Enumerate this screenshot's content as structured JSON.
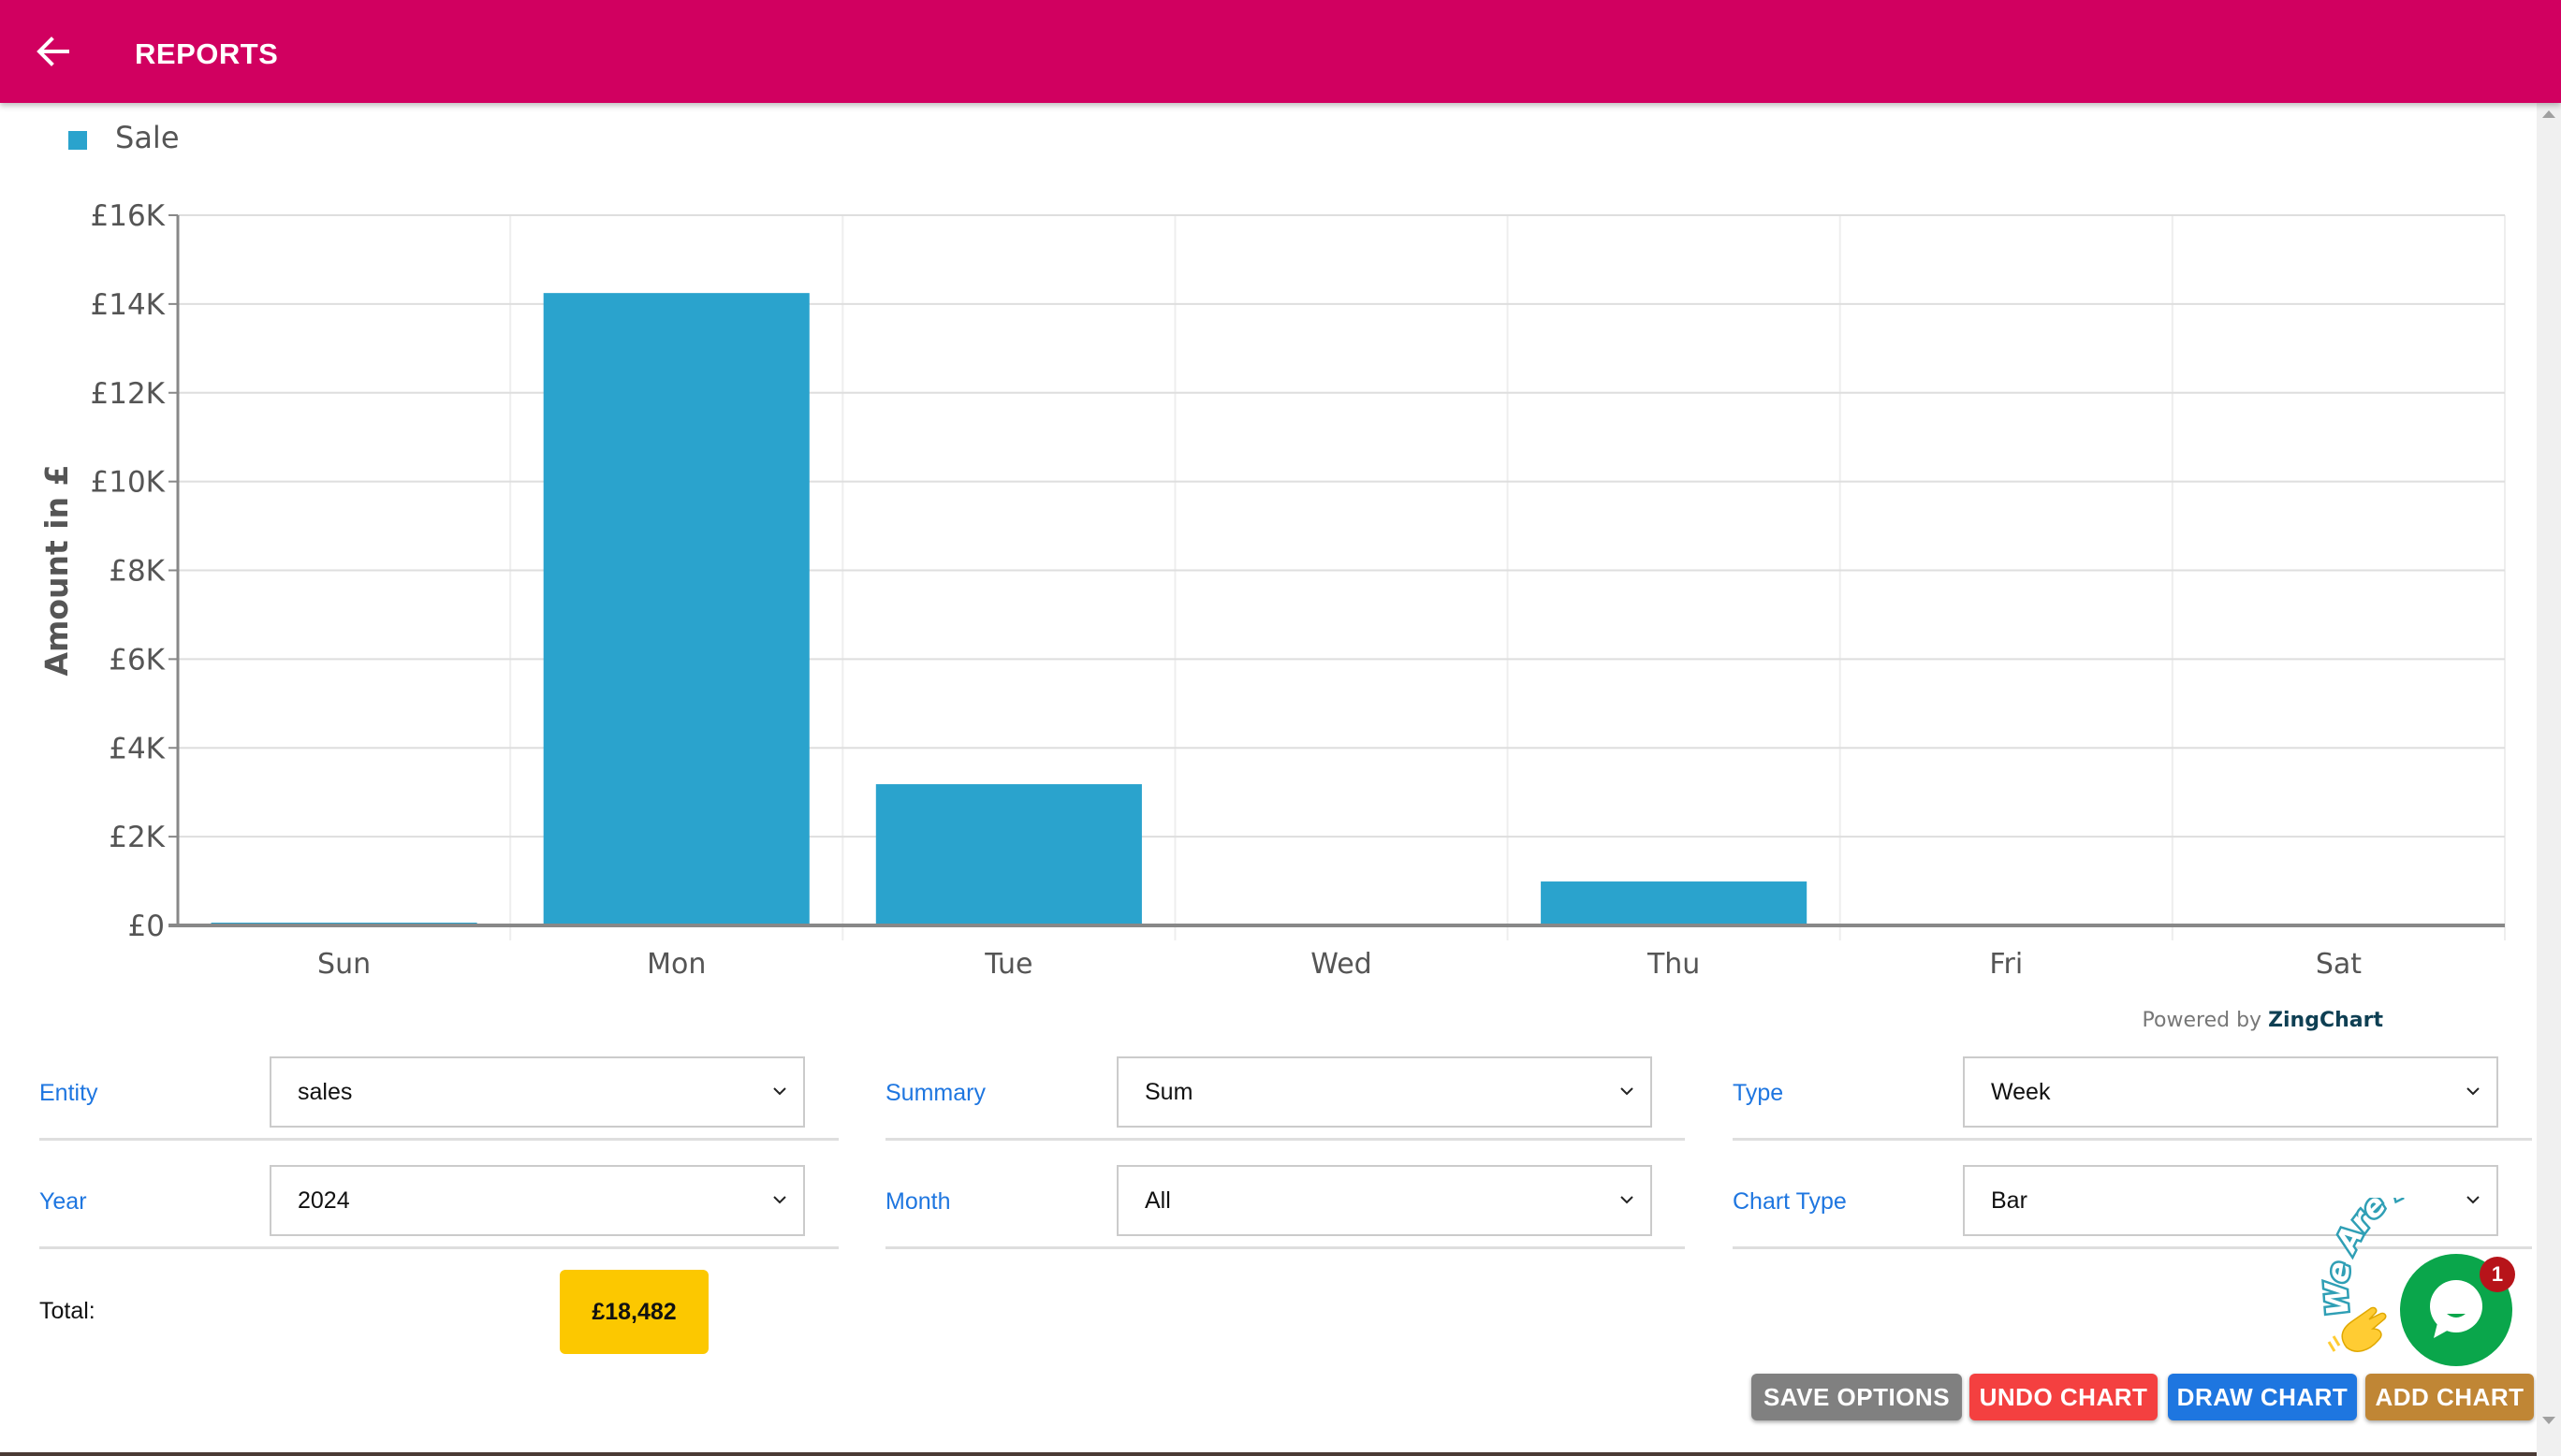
{
  "header": {
    "title": "REPORTS",
    "back_icon": "arrow-left-icon"
  },
  "chart_data": {
    "type": "bar",
    "title": "",
    "legend": {
      "entries": [
        "Sale"
      ],
      "placement": "top-left"
    },
    "categories": [
      "Sun",
      "Mon",
      "Tue",
      "Wed",
      "Thu",
      "Fri",
      "Sat"
    ],
    "series": [
      {
        "name": "Sale",
        "color": "#2aa3cd",
        "values": [
          63,
          14247,
          3182,
          0,
          990,
          0,
          0
        ]
      }
    ],
    "xlabel": "",
    "ylabel": "Amount in £",
    "ylim": [
      0,
      16000
    ],
    "yticks": [
      0,
      2000,
      4000,
      6000,
      8000,
      10000,
      12000,
      14000,
      16000
    ],
    "ytick_labels": [
      "£0",
      "£2K",
      "£4K",
      "£6K",
      "£8K",
      "£10K",
      "£12K",
      "£14K",
      "£16K"
    ],
    "grid": true
  },
  "powered_by": {
    "prefix": "Powered by",
    "brand": "ZingChart"
  },
  "form": {
    "entity": {
      "label": "Entity",
      "value": "sales"
    },
    "year": {
      "label": "Year",
      "value": "2024"
    },
    "summary": {
      "label": "Summary",
      "value": "Sum"
    },
    "month": {
      "label": "Month",
      "value": "All"
    },
    "type": {
      "label": "Type",
      "value": "Week"
    },
    "chart_type": {
      "label": "Chart Type",
      "value": "Bar"
    }
  },
  "total": {
    "label": "Total:",
    "value": "£18,482"
  },
  "buttons": {
    "save": {
      "label": "SAVE OPTIONS",
      "color": "#808080"
    },
    "undo": {
      "label": "UNDO CHART",
      "color": "#f44040"
    },
    "draw": {
      "label": "DRAW CHART",
      "color": "#1e76e0"
    },
    "add": {
      "label": "ADD CHART",
      "color": "#c08635"
    }
  },
  "chat_widget": {
    "banner": "We Are Here!",
    "badge_count": "1",
    "icon": "chat-bubble-icon",
    "wave_icon": "waving-hand-icon"
  },
  "colors": {
    "header": "#d10060",
    "label_blue": "#1e76e0",
    "total_badge": "#fcc800"
  }
}
